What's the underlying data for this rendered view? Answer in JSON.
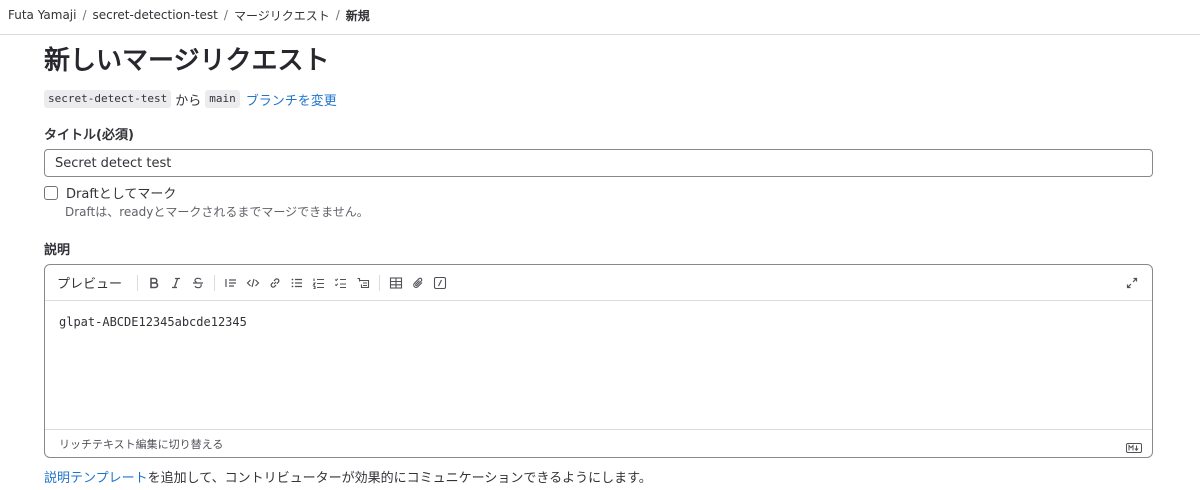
{
  "breadcrumb": {
    "items": [
      "Futa Yamaji",
      "secret-detection-test",
      "マージリクエスト"
    ],
    "current": "新規",
    "separator": "/"
  },
  "page": {
    "title": "新しいマージリクエスト"
  },
  "branches": {
    "source": "secret-detect-test",
    "from_text": "から",
    "target": "main",
    "change_link": "ブランチを変更"
  },
  "title_field": {
    "label": "タイトル(必須)",
    "value": "Secret detect test"
  },
  "draft": {
    "label": "Draftとしてマーク",
    "help": "Draftは、readyとマークされるまでマージできません。",
    "checked": false
  },
  "description": {
    "label": "説明",
    "preview_tab": "プレビュー",
    "content": "glpat-ABCDE12345abcde12345",
    "switch_rich_text": "リッチテキスト編集に切り替える",
    "toolbar_icons": [
      "bold-icon",
      "italic-icon",
      "strikethrough-icon",
      "quote-icon",
      "code-icon",
      "link-icon",
      "bullet-list-icon",
      "numbered-list-icon",
      "task-list-icon",
      "collapsible-icon",
      "table-icon",
      "attach-icon",
      "slash-command-icon"
    ]
  },
  "template_note": {
    "link": "説明テンプレート",
    "text": "を追加して、コントリビューターが効果的にコミュニケーションできるようにします。"
  },
  "colors": {
    "link": "#1f75cb",
    "text": "#333238",
    "border": "#89888d",
    "chip_bg": "#ececef"
  }
}
